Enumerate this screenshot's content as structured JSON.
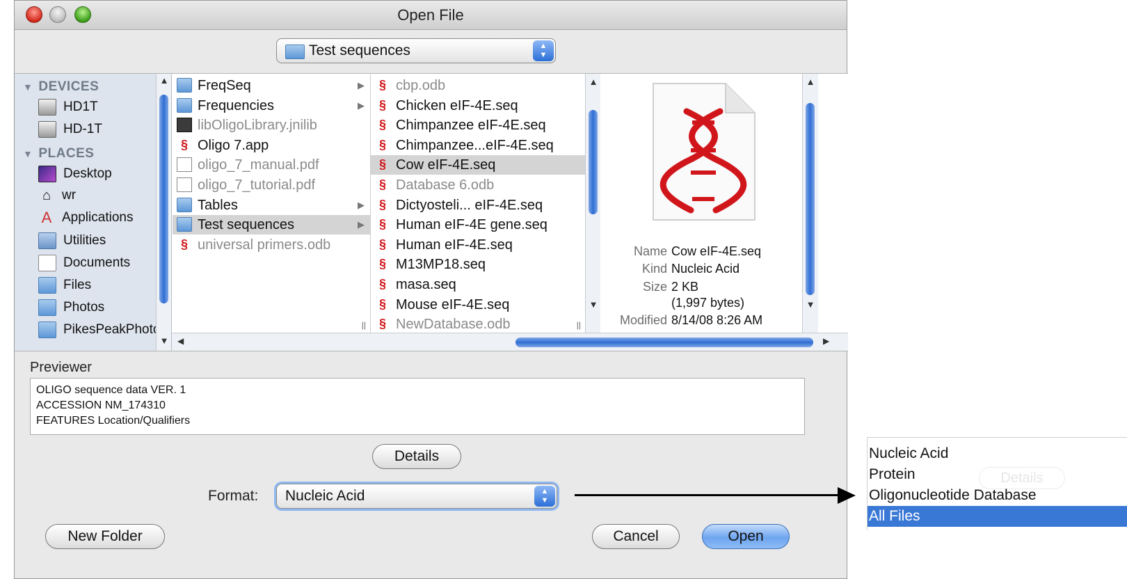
{
  "window": {
    "title": "Open File"
  },
  "location_popup": {
    "value": "Test sequences"
  },
  "sidebar": {
    "devices_header": "DEVICES",
    "devices": [
      "HD1T",
      "HD-1T"
    ],
    "places_header": "PLACES",
    "places": [
      {
        "label": "Desktop",
        "icon": "desktop-icon"
      },
      {
        "label": "wr",
        "icon": "home-icon"
      },
      {
        "label": "Applications",
        "icon": "applications-icon"
      },
      {
        "label": "Utilities",
        "icon": "utilities-icon"
      },
      {
        "label": "Documents",
        "icon": "documents-icon"
      },
      {
        "label": "Files",
        "icon": "folder-icon"
      },
      {
        "label": "Photos",
        "icon": "folder-icon"
      },
      {
        "label": "PikesPeakPhoto",
        "icon": "folder-icon"
      }
    ]
  },
  "column1": [
    {
      "label": "FreqSeq",
      "icon": "folder",
      "chevron": true
    },
    {
      "label": "Frequencies",
      "icon": "folder",
      "chevron": true
    },
    {
      "label": "libOligoLibrary.jnilib",
      "icon": "lib",
      "dim": true
    },
    {
      "label": "Oligo 7.app",
      "icon": "dna"
    },
    {
      "label": "oligo_7_manual.pdf",
      "icon": "doc",
      "dim": true
    },
    {
      "label": "oligo_7_tutorial.pdf",
      "icon": "doc",
      "dim": true
    },
    {
      "label": "Tables",
      "icon": "folder",
      "chevron": true
    },
    {
      "label": "Test sequences",
      "icon": "folder",
      "chevron": true,
      "selected": true
    },
    {
      "label": "universal primers.odb",
      "icon": "dna",
      "dim": true
    }
  ],
  "column2": [
    {
      "label": "cbp.odb",
      "dim": true
    },
    {
      "label": "Chicken eIF-4E.seq"
    },
    {
      "label": "Chimpanzee eIF-4E.seq"
    },
    {
      "label": "Chimpanzee...eIF-4E.seq"
    },
    {
      "label": "Cow eIF-4E.seq",
      "selected": true
    },
    {
      "label": "Database 6.odb",
      "dim": true
    },
    {
      "label": "Dictyosteli... eIF-4E.seq"
    },
    {
      "label": "Human eIF-4E gene.seq"
    },
    {
      "label": "Human eIF-4E.seq"
    },
    {
      "label": "M13MP18.seq"
    },
    {
      "label": "masa.seq"
    },
    {
      "label": "Mouse eIF-4E.seq"
    },
    {
      "label": "NewDatabase.odb",
      "dim": true
    }
  ],
  "file_info": {
    "name_label": "Name",
    "name": "Cow eIF-4E.seq",
    "kind_label": "Kind",
    "kind": "Nucleic Acid",
    "size_label": "Size",
    "size": "2 KB",
    "size_bytes": "(1,997 bytes)",
    "modified_label": "Modified",
    "modified": "8/14/08 8:26 AM"
  },
  "previewer": {
    "label": "Previewer",
    "lines": [
      "OLIGO sequence data VER. 1",
      "ACCESSION NM_174310",
      "FEATURES Location/Qualifiers"
    ]
  },
  "buttons": {
    "details": "Details",
    "new_folder": "New Folder",
    "cancel": "Cancel",
    "open": "Open"
  },
  "format": {
    "label": "Format:",
    "value": "Nucleic Acid"
  },
  "format_dropdown": {
    "options": [
      "Nucleic Acid",
      "Protein",
      "Oligonucleotide Database",
      "All Files"
    ],
    "highlighted": "All Files",
    "ghost_button": "Details"
  },
  "colors": {
    "selection": "#3a78d6",
    "dna": "#d1161b"
  }
}
